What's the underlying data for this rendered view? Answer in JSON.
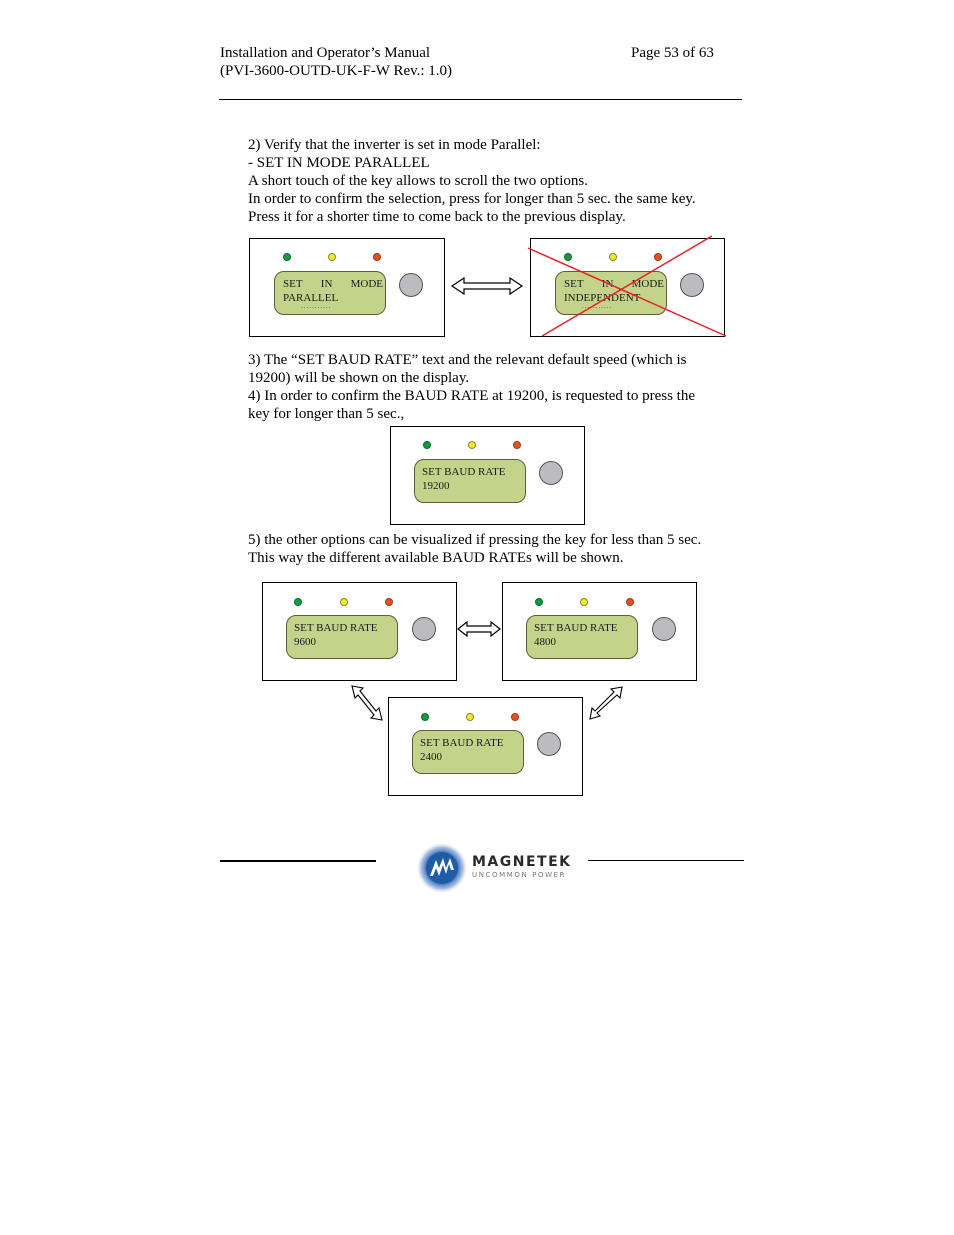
{
  "header": {
    "title_line1": "Installation and Operator’s Manual",
    "title_line2": "(PVI-3600-OUTD-UK-F-W  Rev.: 1.0)",
    "page_label": "Page 53 of 63"
  },
  "section2": {
    "lines": [
      "2) Verify that the inverter is set in mode Parallel:",
      "- SET IN MODE PARALLEL",
      "A short touch of the key allows to scroll the two options.",
      "In order to confirm the selection, press for longer than 5 sec. the same key.",
      "Press it for a shorter time to come back to the previous display."
    ]
  },
  "displays_mode": [
    {
      "line1_words": [
        "SET",
        "IN",
        "MODE"
      ],
      "line2": "PARALLEL",
      "dots": "...........",
      "crossed_out": false
    },
    {
      "line1_words": [
        "SET",
        "IN",
        "MODE"
      ],
      "line2": "INDEPENDENT",
      "dots": "...........",
      "crossed_out": true
    }
  ],
  "section3_4": {
    "lines": [
      "3) The “SET BAUD RATE” text  and the relevant default speed (which is",
      "19200) will be shown on the display.",
      "4) In order to confirm the BAUD RATE at 19200, is requested to press the",
      "key for longer than 5 sec.,"
    ]
  },
  "display_default": {
    "line1": "SET BAUD RATE",
    "line2": "19200"
  },
  "section5": {
    "lines": [
      "5) the other options can be visualized if pressing the key for less than 5 sec.",
      "This way the different available BAUD RATEs will be shown."
    ]
  },
  "displays_baud": [
    {
      "line1": "SET BAUD RATE",
      "line2": "9600"
    },
    {
      "line1": "SET BAUD RATE",
      "line2": "4800"
    },
    {
      "line1": "SET BAUD RATE",
      "line2": "2400"
    }
  ],
  "led_labels": {
    "green": "green-led",
    "yellow": "yellow-led",
    "red": "red-led"
  },
  "colors": {
    "lcd_background": "#c3d48a",
    "led_green": "#159a42",
    "led_yellow": "#f5ec28",
    "led_red": "#e8501c",
    "key_gray": "#bcbcc0",
    "cross_red": "#e8202a",
    "logo_blue": "#1f5ca8"
  },
  "footer": {
    "brand": "MAGNETEK",
    "tagline": "UNCOMMON POWER"
  }
}
